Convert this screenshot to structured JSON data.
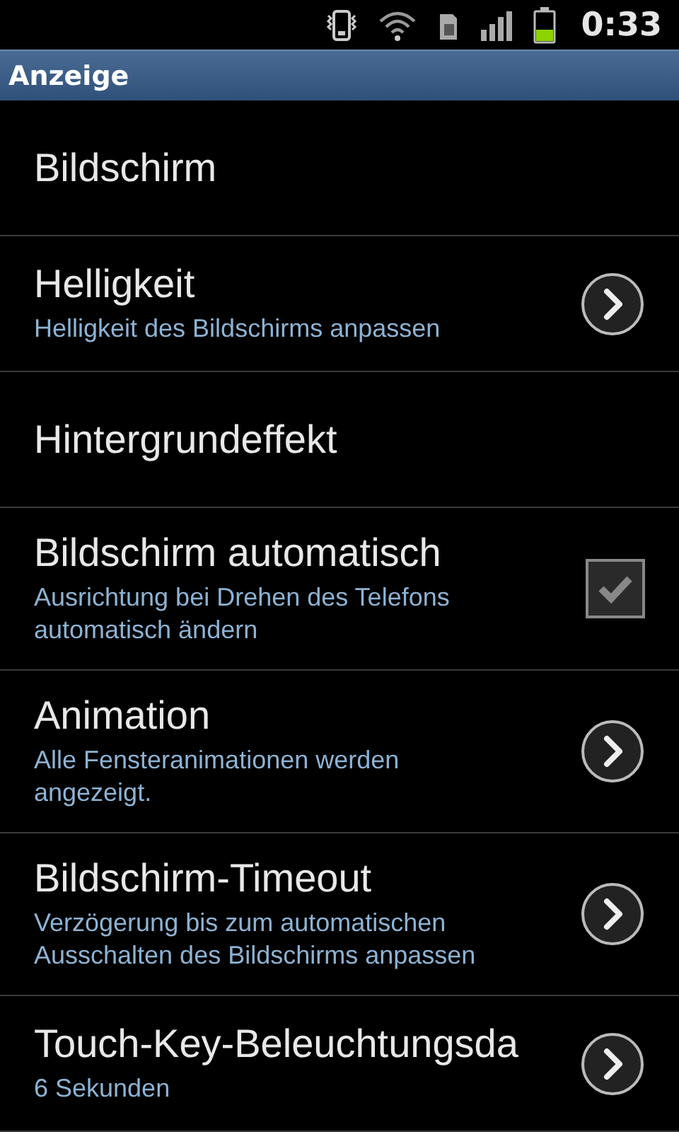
{
  "status_bar": {
    "time": "0:33"
  },
  "title_bar": {
    "title": "Anzeige"
  },
  "items": [
    {
      "kind": "plain",
      "title": "Bildschirm"
    },
    {
      "kind": "link",
      "title": "Helligkeit",
      "subtitle": "Helligkeit des Bildschirms anpassen"
    },
    {
      "kind": "plain",
      "title": "Hintergrundeffekt"
    },
    {
      "kind": "checkbox",
      "title": "Bildschirm automatisch",
      "subtitle": "Ausrichtung bei Drehen des Telefons automatisch ändern",
      "checked": true
    },
    {
      "kind": "link",
      "title": "Animation",
      "subtitle": "Alle Fensteranimationen werden angezeigt."
    },
    {
      "kind": "link",
      "title": "Bildschirm-Timeout",
      "subtitle": "Verzögerung bis zum automatischen Ausschalten des Bildschirms anpassen"
    },
    {
      "kind": "link",
      "title": "Touch-Key-Beleuchtungsda",
      "subtitle": "6 Sekunden"
    }
  ]
}
